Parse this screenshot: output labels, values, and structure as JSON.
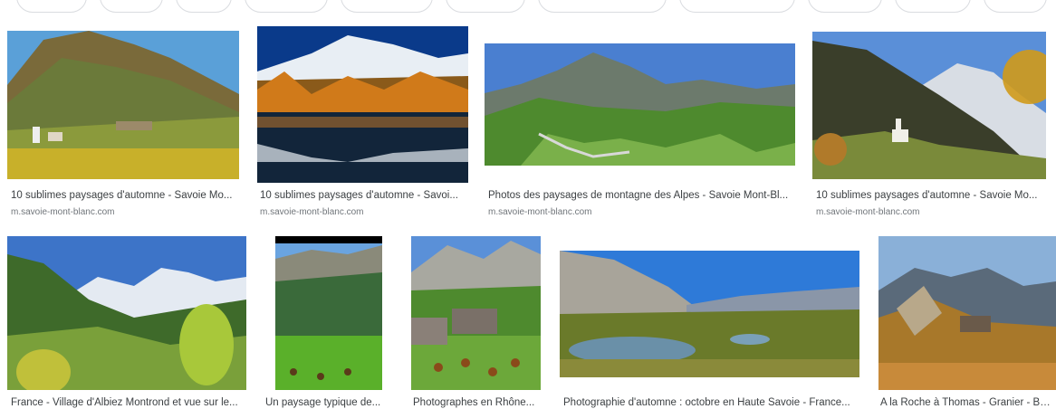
{
  "row1": [
    {
      "caption": "10 sublimes paysages d'automne - Savoie Mo...",
      "source": "m.savoie-mont-blanc.com",
      "scene": "vineyard-village-autumn"
    },
    {
      "caption": "10 sublimes paysages d'automne - Savoi...",
      "source": "m.savoie-mont-blanc.com",
      "scene": "lake-reflection-larches"
    },
    {
      "caption": "Photos des paysages de montagne des Alpes - Savoie Mont-Bl...",
      "source": "m.savoie-mont-blanc.com",
      "scene": "green-valley-river"
    },
    {
      "caption": "10 sublimes paysages d'automne - Savoie Mo...",
      "source": "m.savoie-mont-blanc.com",
      "scene": "chapel-autumn-valley"
    }
  ],
  "row2": [
    {
      "caption": "France - Village d'Albiez Montrond et vue sur le...",
      "scene": "albiez-village-aiguilles"
    },
    {
      "caption": "Un paysage typique de...",
      "scene": "alpine-pasture-cows"
    },
    {
      "caption": "Photographes en Rhône...",
      "scene": "stone-chalet-cows"
    },
    {
      "caption": "Photographie d'automne : octobre en Haute Savoie - France...",
      "scene": "mountain-lake-autumn"
    },
    {
      "caption": "A la Roche à Thomas - Granier - Bauges...",
      "scene": "rocky-ridge-hut"
    }
  ]
}
